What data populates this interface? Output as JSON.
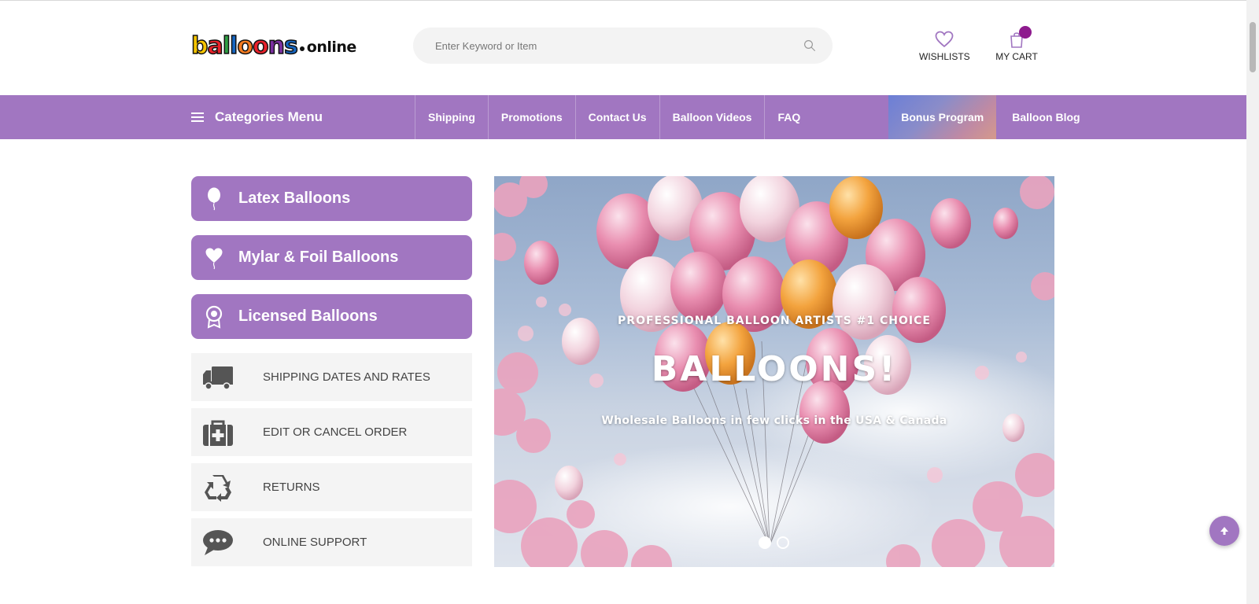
{
  "header": {
    "logo": {
      "word": [
        "b",
        "a",
        "l",
        "l",
        "o",
        "o",
        "n",
        "s"
      ],
      "suffix": "online"
    },
    "search": {
      "placeholder": "Enter Keyword or Item",
      "value": ""
    },
    "wishlists_label": "WISHLISTS",
    "cart_label": "MY CART"
  },
  "nav": {
    "categories_label": "Categories Menu",
    "links": [
      {
        "label": "Shipping"
      },
      {
        "label": "Promotions"
      },
      {
        "label": "Contact Us"
      },
      {
        "label": "Balloon Videos"
      },
      {
        "label": "FAQ"
      }
    ],
    "bonus_label": "Bonus Program",
    "blog_label": "Balloon Blog"
  },
  "sidebar": {
    "categories": [
      {
        "label": "Latex Balloons",
        "icon": "balloon-icon"
      },
      {
        "label": "Mylar & Foil Balloons",
        "icon": "heart-balloon-icon"
      },
      {
        "label": "Licensed Balloons",
        "icon": "award-badge-icon"
      }
    ],
    "info": [
      {
        "label": "SHIPPING DATES AND RATES",
        "icon": "truck-icon"
      },
      {
        "label": "EDIT OR CANCEL ORDER",
        "icon": "medical-bag-icon"
      },
      {
        "label": "RETURNS",
        "icon": "recycle-icon"
      },
      {
        "label": "ONLINE SUPPORT",
        "icon": "chat-bubble-icon"
      }
    ]
  },
  "hero": {
    "kicker": "PROFESSIONAL BALLOON ARTISTS #1 CHOICE",
    "title": "BALLOONS!",
    "subtitle": "Wholesale Balloons in few clicks in the USA & Canada",
    "slide_count": 2,
    "active_slide": 1
  },
  "colors": {
    "brand_purple": "#a176c1",
    "cart_badge": "#8e1b8e",
    "logo_letters": [
      "#f5c400",
      "#e8212a",
      "#2f9e44",
      "#1565c0",
      "#f47b20",
      "#e8212a",
      "#7b2fa0",
      "#1565c0"
    ]
  }
}
